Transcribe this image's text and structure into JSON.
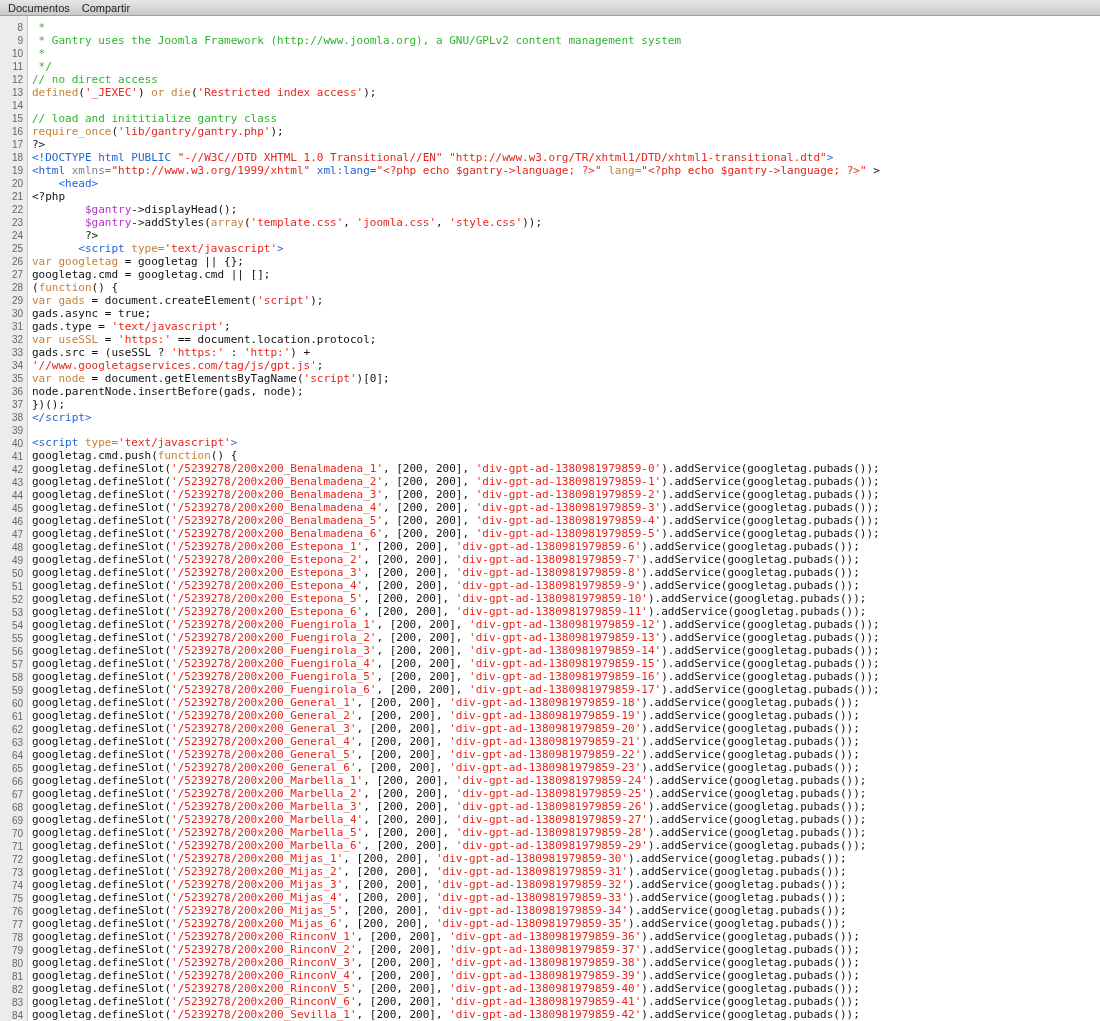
{
  "menu_bar": {
    "items": [
      "Documentos",
      "Compartir"
    ]
  },
  "editor": {
    "lines": [
      {
        "number": "8",
        "tokens": [
          {
            "kind": "comment",
            "text": " *"
          }
        ]
      },
      {
        "number": "9",
        "tokens": [
          {
            "kind": "comment",
            "text": " * Gantry uses the Joomla Framework (http://www.joomla.org), a GNU/GPLv2 content management system"
          }
        ]
      },
      {
        "number": "10",
        "tokens": [
          {
            "kind": "comment",
            "text": " *"
          }
        ]
      },
      {
        "number": "11",
        "tokens": [
          {
            "kind": "comment",
            "text": " */"
          }
        ]
      },
      {
        "number": "12",
        "tokens": [
          {
            "kind": "comment",
            "text": "// no direct access"
          }
        ]
      },
      {
        "number": "13",
        "tokens": [
          {
            "kind": "keyword",
            "text": "defined"
          },
          {
            "kind": "plain",
            "text": "("
          },
          {
            "kind": "string",
            "text": "'_JEXEC'"
          },
          {
            "kind": "plain",
            "text": ") "
          },
          {
            "kind": "keyword",
            "text": "or die"
          },
          {
            "kind": "plain",
            "text": "("
          },
          {
            "kind": "string",
            "text": "'Restricted index access'"
          },
          {
            "kind": "plain",
            "text": ");"
          }
        ]
      },
      {
        "number": "14"
      },
      {
        "number": "15",
        "tokens": [
          {
            "kind": "comment",
            "text": "// load and inititialize gantry class"
          }
        ]
      },
      {
        "number": "16",
        "tokens": [
          {
            "kind": "keyword",
            "text": "require_once"
          },
          {
            "kind": "plain",
            "text": "("
          },
          {
            "kind": "string",
            "text": "'lib/gantry/gantry.php'"
          },
          {
            "kind": "plain",
            "text": ");"
          }
        ]
      },
      {
        "number": "17",
        "tokens": [
          {
            "kind": "plain",
            "text": "?>"
          }
        ]
      },
      {
        "number": "18",
        "tokens": [
          {
            "kind": "tag",
            "text": "<!DOCTYPE html PUBLIC "
          },
          {
            "kind": "string",
            "text": "\"-//W3C//DTD XHTML 1.0 Transitional//EN\" \"http://www.w3.org/TR/xhtml1/DTD/xhtml1-transitional.dtd\""
          },
          {
            "kind": "tag",
            "text": ">"
          }
        ]
      },
      {
        "number": "19",
        "tokens": [
          {
            "kind": "tag",
            "text": "<html "
          },
          {
            "kind": "attr",
            "text": "xmlns="
          },
          {
            "kind": "string",
            "text": "\"http://www.w3.org/1999/xhtml\" "
          },
          {
            "kind": "tag",
            "text": "xml:lang="
          },
          {
            "kind": "string",
            "text": "\"<?php echo $gantry->language; ?>\" "
          },
          {
            "kind": "keyword",
            "text": "lang="
          },
          {
            "kind": "string",
            "text": "\"<?php echo $gantry->language; ?>\""
          },
          {
            "kind": "plain",
            "text": " >"
          }
        ]
      },
      {
        "number": "20",
        "tokens": [
          {
            "kind": "tag",
            "text": "    <head>"
          }
        ]
      },
      {
        "number": "21",
        "tokens": [
          {
            "kind": "plain",
            "text": "<?php"
          }
        ]
      },
      {
        "number": "22",
        "tokens": [
          {
            "kind": "variable",
            "text": "        $gantry"
          },
          {
            "kind": "plain",
            "text": "->displayHead();"
          }
        ]
      },
      {
        "number": "23",
        "tokens": [
          {
            "kind": "variable",
            "text": "        $gantry"
          },
          {
            "kind": "plain",
            "text": "->addStyles("
          },
          {
            "kind": "keyword",
            "text": "array"
          },
          {
            "kind": "plain",
            "text": "("
          },
          {
            "kind": "string",
            "text": "'template.css'"
          },
          {
            "kind": "plain",
            "text": ", "
          },
          {
            "kind": "string",
            "text": "'joomla.css'"
          },
          {
            "kind": "plain",
            "text": ", "
          },
          {
            "kind": "string",
            "text": "'style.css'"
          },
          {
            "kind": "plain",
            "text": "));"
          }
        ]
      },
      {
        "number": "24",
        "tokens": [
          {
            "kind": "plain",
            "text": "        ?>"
          }
        ]
      },
      {
        "number": "25",
        "tokens": [
          {
            "kind": "tag",
            "text": "       <script "
          },
          {
            "kind": "keyword",
            "text": "type="
          },
          {
            "kind": "string",
            "text": "'text/javascript'"
          },
          {
            "kind": "tag",
            "text": ">"
          }
        ]
      },
      {
        "number": "26",
        "tokens": [
          {
            "kind": "keyword",
            "text": "var googletag"
          },
          {
            "kind": "plain",
            "text": " = googletag || {};"
          }
        ]
      },
      {
        "number": "27",
        "tokens": [
          {
            "kind": "plain",
            "text": "googletag.cmd = googletag.cmd || [];"
          }
        ]
      },
      {
        "number": "28",
        "tokens": [
          {
            "kind": "plain",
            "text": "("
          },
          {
            "kind": "keyword",
            "text": "function"
          },
          {
            "kind": "plain",
            "text": "() {"
          }
        ]
      },
      {
        "number": "29",
        "tokens": [
          {
            "kind": "keyword",
            "text": "var gads"
          },
          {
            "kind": "plain",
            "text": " = document.createElement("
          },
          {
            "kind": "string",
            "text": "'script'"
          },
          {
            "kind": "plain",
            "text": ");"
          }
        ]
      },
      {
        "number": "30",
        "tokens": [
          {
            "kind": "plain",
            "text": "gads.async = true;"
          }
        ]
      },
      {
        "number": "31",
        "tokens": [
          {
            "kind": "plain",
            "text": "gads.type = "
          },
          {
            "kind": "string",
            "text": "'text/javascript'"
          },
          {
            "kind": "plain",
            "text": ";"
          }
        ]
      },
      {
        "number": "32",
        "tokens": [
          {
            "kind": "keyword",
            "text": "var useSSL"
          },
          {
            "kind": "plain",
            "text": " = "
          },
          {
            "kind": "string",
            "text": "'https:'"
          },
          {
            "kind": "plain",
            "text": " == document.location.protocol;"
          }
        ]
      },
      {
        "number": "33",
        "tokens": [
          {
            "kind": "plain",
            "text": "gads.src = (useSSL ? "
          },
          {
            "kind": "string",
            "text": "'https:'"
          },
          {
            "kind": "plain",
            "text": " : "
          },
          {
            "kind": "string",
            "text": "'http:'"
          },
          {
            "kind": "plain",
            "text": ") +"
          }
        ]
      },
      {
        "number": "34",
        "tokens": [
          {
            "kind": "string",
            "text": "'//www.googletagservices.com/tag/js/gpt.js'"
          },
          {
            "kind": "plain",
            "text": ";"
          }
        ]
      },
      {
        "number": "35",
        "tokens": [
          {
            "kind": "keyword",
            "text": "var node"
          },
          {
            "kind": "plain",
            "text": " = document.getElementsByTagName("
          },
          {
            "kind": "string",
            "text": "'script'"
          },
          {
            "kind": "plain",
            "text": ")[0];"
          }
        ]
      },
      {
        "number": "36",
        "tokens": [
          {
            "kind": "plain",
            "text": "node.parentNode.insertBefore(gads, node);"
          }
        ]
      },
      {
        "number": "37",
        "tokens": [
          {
            "kind": "plain",
            "text": "})();"
          }
        ]
      },
      {
        "number": "38",
        "tokens": [
          {
            "kind": "tag",
            "text": "</script>"
          }
        ]
      },
      {
        "number": "39"
      },
      {
        "number": "40",
        "tokens": [
          {
            "kind": "tag",
            "text": "<script "
          },
          {
            "kind": "keyword",
            "text": "type="
          },
          {
            "kind": "string",
            "text": "'text/javascript'"
          },
          {
            "kind": "tag",
            "text": ">"
          }
        ]
      },
      {
        "number": "41",
        "tokens": [
          {
            "kind": "plain",
            "text": "googletag.cmd.push("
          },
          {
            "kind": "keyword",
            "text": "function"
          },
          {
            "kind": "plain",
            "text": "() {"
          }
        ]
      },
      {
        "number": "42",
        "tokens": [
          {
            "kind": "plain",
            "text": "googletag.defineSlot("
          },
          {
            "kind": "string",
            "text": "'/5239278/200x200_Benalmadena_1'"
          },
          {
            "kind": "plain",
            "text": ", [200, 200], "
          },
          {
            "kind": "string",
            "text": "'div-gpt-ad-1380981979859-0'"
          },
          {
            "kind": "plain",
            "text": ").addService(googletag.pubads());"
          }
        ]
      },
      {
        "number": "43",
        "tokens": [
          {
            "kind": "plain",
            "text": "googletag.defineSlot("
          },
          {
            "kind": "string",
            "text": "'/5239278/200x200_Benalmadena_2'"
          },
          {
            "kind": "plain",
            "text": ", [200, 200], "
          },
          {
            "kind": "string",
            "text": "'div-gpt-ad-1380981979859-1'"
          },
          {
            "kind": "plain",
            "text": ").addService(googletag.pubads());"
          }
        ]
      },
      {
        "number": "44",
        "tokens": [
          {
            "kind": "plain",
            "text": "googletag.defineSlot("
          },
          {
            "kind": "string",
            "text": "'/5239278/200x200_Benalmadena_3'"
          },
          {
            "kind": "plain",
            "text": ", [200, 200], "
          },
          {
            "kind": "string",
            "text": "'div-gpt-ad-1380981979859-2'"
          },
          {
            "kind": "plain",
            "text": ").addService(googletag.pubads());"
          }
        ]
      },
      {
        "number": "45",
        "tokens": [
          {
            "kind": "plain",
            "text": "googletag.defineSlot("
          },
          {
            "kind": "string",
            "text": "'/5239278/200x200_Benalmadena_4'"
          },
          {
            "kind": "plain",
            "text": ", [200, 200], "
          },
          {
            "kind": "string",
            "text": "'div-gpt-ad-1380981979859-3'"
          },
          {
            "kind": "plain",
            "text": ").addService(googletag.pubads());"
          }
        ]
      },
      {
        "number": "46",
        "tokens": [
          {
            "kind": "plain",
            "text": "googletag.defineSlot("
          },
          {
            "kind": "string",
            "text": "'/5239278/200x200_Benalmadena_5'"
          },
          {
            "kind": "plain",
            "text": ", [200, 200], "
          },
          {
            "kind": "string",
            "text": "'div-gpt-ad-1380981979859-4'"
          },
          {
            "kind": "plain",
            "text": ").addService(googletag.pubads());"
          }
        ]
      },
      {
        "number": "47",
        "tokens": [
          {
            "kind": "plain",
            "text": "googletag.defineSlot("
          },
          {
            "kind": "string",
            "text": "'/5239278/200x200_Benalmadena_6'"
          },
          {
            "kind": "plain",
            "text": ", [200, 200], "
          },
          {
            "kind": "string",
            "text": "'div-gpt-ad-1380981979859-5'"
          },
          {
            "kind": "plain",
            "text": ").addService(googletag.pubads());"
          }
        ]
      },
      {
        "number": "48",
        "tokens": [
          {
            "kind": "plain",
            "text": "googletag.defineSlot("
          },
          {
            "kind": "string",
            "text": "'/5239278/200x200_Estepona_1'"
          },
          {
            "kind": "plain",
            "text": ", [200, 200], "
          },
          {
            "kind": "string",
            "text": "'div-gpt-ad-1380981979859-6'"
          },
          {
            "kind": "plain",
            "text": ").addService(googletag.pubads());"
          }
        ]
      },
      {
        "number": "49",
        "tokens": [
          {
            "kind": "plain",
            "text": "googletag.defineSlot("
          },
          {
            "kind": "string",
            "text": "'/5239278/200x200_Estepona_2'"
          },
          {
            "kind": "plain",
            "text": ", [200, 200], "
          },
          {
            "kind": "string",
            "text": "'div-gpt-ad-1380981979859-7'"
          },
          {
            "kind": "plain",
            "text": ").addService(googletag.pubads());"
          }
        ]
      },
      {
        "number": "50",
        "tokens": [
          {
            "kind": "plain",
            "text": "googletag.defineSlot("
          },
          {
            "kind": "string",
            "text": "'/5239278/200x200_Estepona_3'"
          },
          {
            "kind": "plain",
            "text": ", [200, 200], "
          },
          {
            "kind": "string",
            "text": "'div-gpt-ad-1380981979859-8'"
          },
          {
            "kind": "plain",
            "text": ").addService(googletag.pubads());"
          }
        ]
      },
      {
        "number": "51",
        "tokens": [
          {
            "kind": "plain",
            "text": "googletag.defineSlot("
          },
          {
            "kind": "string",
            "text": "'/5239278/200x200_Estepona_4'"
          },
          {
            "kind": "plain",
            "text": ", [200, 200], "
          },
          {
            "kind": "string",
            "text": "'div-gpt-ad-1380981979859-9'"
          },
          {
            "kind": "plain",
            "text": ").addService(googletag.pubads());"
          }
        ]
      },
      {
        "number": "52",
        "tokens": [
          {
            "kind": "plain",
            "text": "googletag.defineSlot("
          },
          {
            "kind": "string",
            "text": "'/5239278/200x200_Estepona_5'"
          },
          {
            "kind": "plain",
            "text": ", [200, 200], "
          },
          {
            "kind": "string",
            "text": "'div-gpt-ad-1380981979859-10'"
          },
          {
            "kind": "plain",
            "text": ").addService(googletag.pubads());"
          }
        ]
      },
      {
        "number": "53",
        "tokens": [
          {
            "kind": "plain",
            "text": "googletag.defineSlot("
          },
          {
            "kind": "string",
            "text": "'/5239278/200x200_Estepona_6'"
          },
          {
            "kind": "plain",
            "text": ", [200, 200], "
          },
          {
            "kind": "string",
            "text": "'div-gpt-ad-1380981979859-11'"
          },
          {
            "kind": "plain",
            "text": ").addService(googletag.pubads());"
          }
        ]
      },
      {
        "number": "54",
        "tokens": [
          {
            "kind": "plain",
            "text": "googletag.defineSlot("
          },
          {
            "kind": "string",
            "text": "'/5239278/200x200_Fuengirola_1'"
          },
          {
            "kind": "plain",
            "text": ", [200, 200], "
          },
          {
            "kind": "string",
            "text": "'div-gpt-ad-1380981979859-12'"
          },
          {
            "kind": "plain",
            "text": ").addService(googletag.pubads());"
          }
        ]
      },
      {
        "number": "55",
        "tokens": [
          {
            "kind": "plain",
            "text": "googletag.defineSlot("
          },
          {
            "kind": "string",
            "text": "'/5239278/200x200_Fuengirola_2'"
          },
          {
            "kind": "plain",
            "text": ", [200, 200], "
          },
          {
            "kind": "string",
            "text": "'div-gpt-ad-1380981979859-13'"
          },
          {
            "kind": "plain",
            "text": ").addService(googletag.pubads());"
          }
        ]
      },
      {
        "number": "56",
        "tokens": [
          {
            "kind": "plain",
            "text": "googletag.defineSlot("
          },
          {
            "kind": "string",
            "text": "'/5239278/200x200_Fuengirola_3'"
          },
          {
            "kind": "plain",
            "text": ", [200, 200], "
          },
          {
            "kind": "string",
            "text": "'div-gpt-ad-1380981979859-14'"
          },
          {
            "kind": "plain",
            "text": ").addService(googletag.pubads());"
          }
        ]
      },
      {
        "number": "57",
        "tokens": [
          {
            "kind": "plain",
            "text": "googletag.defineSlot("
          },
          {
            "kind": "string",
            "text": "'/5239278/200x200_Fuengirola_4'"
          },
          {
            "kind": "plain",
            "text": ", [200, 200], "
          },
          {
            "kind": "string",
            "text": "'div-gpt-ad-1380981979859-15'"
          },
          {
            "kind": "plain",
            "text": ").addService(googletag.pubads());"
          }
        ]
      },
      {
        "number": "58",
        "tokens": [
          {
            "kind": "plain",
            "text": "googletag.defineSlot("
          },
          {
            "kind": "string",
            "text": "'/5239278/200x200_Fuengirola_5'"
          },
          {
            "kind": "plain",
            "text": ", [200, 200], "
          },
          {
            "kind": "string",
            "text": "'div-gpt-ad-1380981979859-16'"
          },
          {
            "kind": "plain",
            "text": ").addService(googletag.pubads());"
          }
        ]
      },
      {
        "number": "59",
        "tokens": [
          {
            "kind": "plain",
            "text": "googletag.defineSlot("
          },
          {
            "kind": "string",
            "text": "'/5239278/200x200_Fuengirola_6'"
          },
          {
            "kind": "plain",
            "text": ", [200, 200], "
          },
          {
            "kind": "string",
            "text": "'div-gpt-ad-1380981979859-17'"
          },
          {
            "kind": "plain",
            "text": ").addService(googletag.pubads());"
          }
        ]
      },
      {
        "number": "60",
        "tokens": [
          {
            "kind": "plain",
            "text": "googletag.defineSlot("
          },
          {
            "kind": "string",
            "text": "'/5239278/200x200_General_1'"
          },
          {
            "kind": "plain",
            "text": ", [200, 200], "
          },
          {
            "kind": "string",
            "text": "'div-gpt-ad-1380981979859-18'"
          },
          {
            "kind": "plain",
            "text": ").addService(googletag.pubads());"
          }
        ]
      },
      {
        "number": "61",
        "tokens": [
          {
            "kind": "plain",
            "text": "googletag.defineSlot("
          },
          {
            "kind": "string",
            "text": "'/5239278/200x200_General_2'"
          },
          {
            "kind": "plain",
            "text": ", [200, 200], "
          },
          {
            "kind": "string",
            "text": "'div-gpt-ad-1380981979859-19'"
          },
          {
            "kind": "plain",
            "text": ").addService(googletag.pubads());"
          }
        ]
      },
      {
        "number": "62",
        "tokens": [
          {
            "kind": "plain",
            "text": "googletag.defineSlot("
          },
          {
            "kind": "string",
            "text": "'/5239278/200x200_General_3'"
          },
          {
            "kind": "plain",
            "text": ", [200, 200], "
          },
          {
            "kind": "string",
            "text": "'div-gpt-ad-1380981979859-20'"
          },
          {
            "kind": "plain",
            "text": ").addService(googletag.pubads());"
          }
        ]
      },
      {
        "number": "63",
        "tokens": [
          {
            "kind": "plain",
            "text": "googletag.defineSlot("
          },
          {
            "kind": "string",
            "text": "'/5239278/200x200_General_4'"
          },
          {
            "kind": "plain",
            "text": ", [200, 200], "
          },
          {
            "kind": "string",
            "text": "'div-gpt-ad-1380981979859-21'"
          },
          {
            "kind": "plain",
            "text": ").addService(googletag.pubads());"
          }
        ]
      },
      {
        "number": "64",
        "tokens": [
          {
            "kind": "plain",
            "text": "googletag.defineSlot("
          },
          {
            "kind": "string",
            "text": "'/5239278/200x200_General_5'"
          },
          {
            "kind": "plain",
            "text": ", [200, 200], "
          },
          {
            "kind": "string",
            "text": "'div-gpt-ad-1380981979859-22'"
          },
          {
            "kind": "plain",
            "text": ").addService(googletag.pubads());"
          }
        ]
      },
      {
        "number": "65",
        "tokens": [
          {
            "kind": "plain",
            "text": "googletag.defineSlot("
          },
          {
            "kind": "string",
            "text": "'/5239278/200x200_General_6'"
          },
          {
            "kind": "plain",
            "text": ", [200, 200], "
          },
          {
            "kind": "string",
            "text": "'div-gpt-ad-1380981979859-23'"
          },
          {
            "kind": "plain",
            "text": ").addService(googletag.pubads());"
          }
        ]
      },
      {
        "number": "66",
        "tokens": [
          {
            "kind": "plain",
            "text": "googletag.defineSlot("
          },
          {
            "kind": "string",
            "text": "'/5239278/200x200_Marbella_1'"
          },
          {
            "kind": "plain",
            "text": ", [200, 200], "
          },
          {
            "kind": "string",
            "text": "'div-gpt-ad-1380981979859-24'"
          },
          {
            "kind": "plain",
            "text": ").addService(googletag.pubads());"
          }
        ]
      },
      {
        "number": "67",
        "tokens": [
          {
            "kind": "plain",
            "text": "googletag.defineSlot("
          },
          {
            "kind": "string",
            "text": "'/5239278/200x200_Marbella_2'"
          },
          {
            "kind": "plain",
            "text": ", [200, 200], "
          },
          {
            "kind": "string",
            "text": "'div-gpt-ad-1380981979859-25'"
          },
          {
            "kind": "plain",
            "text": ").addService(googletag.pubads());"
          }
        ]
      },
      {
        "number": "68",
        "tokens": [
          {
            "kind": "plain",
            "text": "googletag.defineSlot("
          },
          {
            "kind": "string",
            "text": "'/5239278/200x200_Marbella_3'"
          },
          {
            "kind": "plain",
            "text": ", [200, 200], "
          },
          {
            "kind": "string",
            "text": "'div-gpt-ad-1380981979859-26'"
          },
          {
            "kind": "plain",
            "text": ").addService(googletag.pubads());"
          }
        ]
      },
      {
        "number": "69",
        "tokens": [
          {
            "kind": "plain",
            "text": "googletag.defineSlot("
          },
          {
            "kind": "string",
            "text": "'/5239278/200x200_Marbella_4'"
          },
          {
            "kind": "plain",
            "text": ", [200, 200], "
          },
          {
            "kind": "string",
            "text": "'div-gpt-ad-1380981979859-27'"
          },
          {
            "kind": "plain",
            "text": ").addService(googletag.pubads());"
          }
        ]
      },
      {
        "number": "70",
        "tokens": [
          {
            "kind": "plain",
            "text": "googletag.defineSlot("
          },
          {
            "kind": "string",
            "text": "'/5239278/200x200_Marbella_5'"
          },
          {
            "kind": "plain",
            "text": ", [200, 200], "
          },
          {
            "kind": "string",
            "text": "'div-gpt-ad-1380981979859-28'"
          },
          {
            "kind": "plain",
            "text": ").addService(googletag.pubads());"
          }
        ]
      },
      {
        "number": "71",
        "tokens": [
          {
            "kind": "plain",
            "text": "googletag.defineSlot("
          },
          {
            "kind": "string",
            "text": "'/5239278/200x200_Marbella_6'"
          },
          {
            "kind": "plain",
            "text": ", [200, 200], "
          },
          {
            "kind": "string",
            "text": "'div-gpt-ad-1380981979859-29'"
          },
          {
            "kind": "plain",
            "text": ").addService(googletag.pubads());"
          }
        ]
      },
      {
        "number": "72",
        "tokens": [
          {
            "kind": "plain",
            "text": "googletag.defineSlot("
          },
          {
            "kind": "string",
            "text": "'/5239278/200x200_Mijas_1'"
          },
          {
            "kind": "plain",
            "text": ", [200, 200], "
          },
          {
            "kind": "string",
            "text": "'div-gpt-ad-1380981979859-30'"
          },
          {
            "kind": "plain",
            "text": ").addService(googletag.pubads());"
          }
        ]
      },
      {
        "number": "73",
        "tokens": [
          {
            "kind": "plain",
            "text": "googletag.defineSlot("
          },
          {
            "kind": "string",
            "text": "'/5239278/200x200_Mijas_2'"
          },
          {
            "kind": "plain",
            "text": ", [200, 200], "
          },
          {
            "kind": "string",
            "text": "'div-gpt-ad-1380981979859-31'"
          },
          {
            "kind": "plain",
            "text": ").addService(googletag.pubads());"
          }
        ]
      },
      {
        "number": "74",
        "tokens": [
          {
            "kind": "plain",
            "text": "googletag.defineSlot("
          },
          {
            "kind": "string",
            "text": "'/5239278/200x200_Mijas_3'"
          },
          {
            "kind": "plain",
            "text": ", [200, 200], "
          },
          {
            "kind": "string",
            "text": "'div-gpt-ad-1380981979859-32'"
          },
          {
            "kind": "plain",
            "text": ").addService(googletag.pubads());"
          }
        ]
      },
      {
        "number": "75",
        "tokens": [
          {
            "kind": "plain",
            "text": "googletag.defineSlot("
          },
          {
            "kind": "string",
            "text": "'/5239278/200x200_Mijas_4'"
          },
          {
            "kind": "plain",
            "text": ", [200, 200], "
          },
          {
            "kind": "string",
            "text": "'div-gpt-ad-1380981979859-33'"
          },
          {
            "kind": "plain",
            "text": ").addService(googletag.pubads());"
          }
        ]
      },
      {
        "number": "76",
        "tokens": [
          {
            "kind": "plain",
            "text": "googletag.defineSlot("
          },
          {
            "kind": "string",
            "text": "'/5239278/200x200_Mijas_5'"
          },
          {
            "kind": "plain",
            "text": ", [200, 200], "
          },
          {
            "kind": "string",
            "text": "'div-gpt-ad-1380981979859-34'"
          },
          {
            "kind": "plain",
            "text": ").addService(googletag.pubads());"
          }
        ]
      },
      {
        "number": "77",
        "tokens": [
          {
            "kind": "plain",
            "text": "googletag.defineSlot("
          },
          {
            "kind": "string",
            "text": "'/5239278/200x200_Mijas_6'"
          },
          {
            "kind": "plain",
            "text": ", [200, 200], "
          },
          {
            "kind": "string",
            "text": "'div-gpt-ad-1380981979859-35'"
          },
          {
            "kind": "plain",
            "text": ").addService(googletag.pubads());"
          }
        ]
      },
      {
        "number": "78",
        "tokens": [
          {
            "kind": "plain",
            "text": "googletag.defineSlot("
          },
          {
            "kind": "string",
            "text": "'/5239278/200x200_RinconV_1'"
          },
          {
            "kind": "plain",
            "text": ", [200, 200], "
          },
          {
            "kind": "string",
            "text": "'div-gpt-ad-1380981979859-36'"
          },
          {
            "kind": "plain",
            "text": ").addService(googletag.pubads());"
          }
        ]
      },
      {
        "number": "79",
        "tokens": [
          {
            "kind": "plain",
            "text": "googletag.defineSlot("
          },
          {
            "kind": "string",
            "text": "'/5239278/200x200_RinconV_2'"
          },
          {
            "kind": "plain",
            "text": ", [200, 200], "
          },
          {
            "kind": "string",
            "text": "'div-gpt-ad-1380981979859-37'"
          },
          {
            "kind": "plain",
            "text": ").addService(googletag.pubads());"
          }
        ]
      },
      {
        "number": "80",
        "tokens": [
          {
            "kind": "plain",
            "text": "googletag.defineSlot("
          },
          {
            "kind": "string",
            "text": "'/5239278/200x200_RinconV_3'"
          },
          {
            "kind": "plain",
            "text": ", [200, 200], "
          },
          {
            "kind": "string",
            "text": "'div-gpt-ad-1380981979859-38'"
          },
          {
            "kind": "plain",
            "text": ").addService(googletag.pubads());"
          }
        ]
      },
      {
        "number": "81",
        "tokens": [
          {
            "kind": "plain",
            "text": "googletag.defineSlot("
          },
          {
            "kind": "string",
            "text": "'/5239278/200x200_RinconV_4'"
          },
          {
            "kind": "plain",
            "text": ", [200, 200], "
          },
          {
            "kind": "string",
            "text": "'div-gpt-ad-1380981979859-39'"
          },
          {
            "kind": "plain",
            "text": ").addService(googletag.pubads());"
          }
        ]
      },
      {
        "number": "82",
        "tokens": [
          {
            "kind": "plain",
            "text": "googletag.defineSlot("
          },
          {
            "kind": "string",
            "text": "'/5239278/200x200_RinconV_5'"
          },
          {
            "kind": "plain",
            "text": ", [200, 200], "
          },
          {
            "kind": "string",
            "text": "'div-gpt-ad-1380981979859-40'"
          },
          {
            "kind": "plain",
            "text": ").addService(googletag.pubads());"
          }
        ]
      },
      {
        "number": "83",
        "tokens": [
          {
            "kind": "plain",
            "text": "googletag.defineSlot("
          },
          {
            "kind": "string",
            "text": "'/5239278/200x200_RinconV_6'"
          },
          {
            "kind": "plain",
            "text": ", [200, 200], "
          },
          {
            "kind": "string",
            "text": "'div-gpt-ad-1380981979859-41'"
          },
          {
            "kind": "plain",
            "text": ").addService(googletag.pubads());"
          }
        ]
      },
      {
        "number": "84",
        "tokens": [
          {
            "kind": "plain",
            "text": "googletag.defineSlot("
          },
          {
            "kind": "string",
            "text": "'/5239278/200x200_Sevilla_1'"
          },
          {
            "kind": "plain",
            "text": ", [200, 200], "
          },
          {
            "kind": "string",
            "text": "'div-gpt-ad-1380981979859-42'"
          },
          {
            "kind": "plain",
            "text": ").addService(googletag.pubads());"
          }
        ]
      }
    ]
  }
}
